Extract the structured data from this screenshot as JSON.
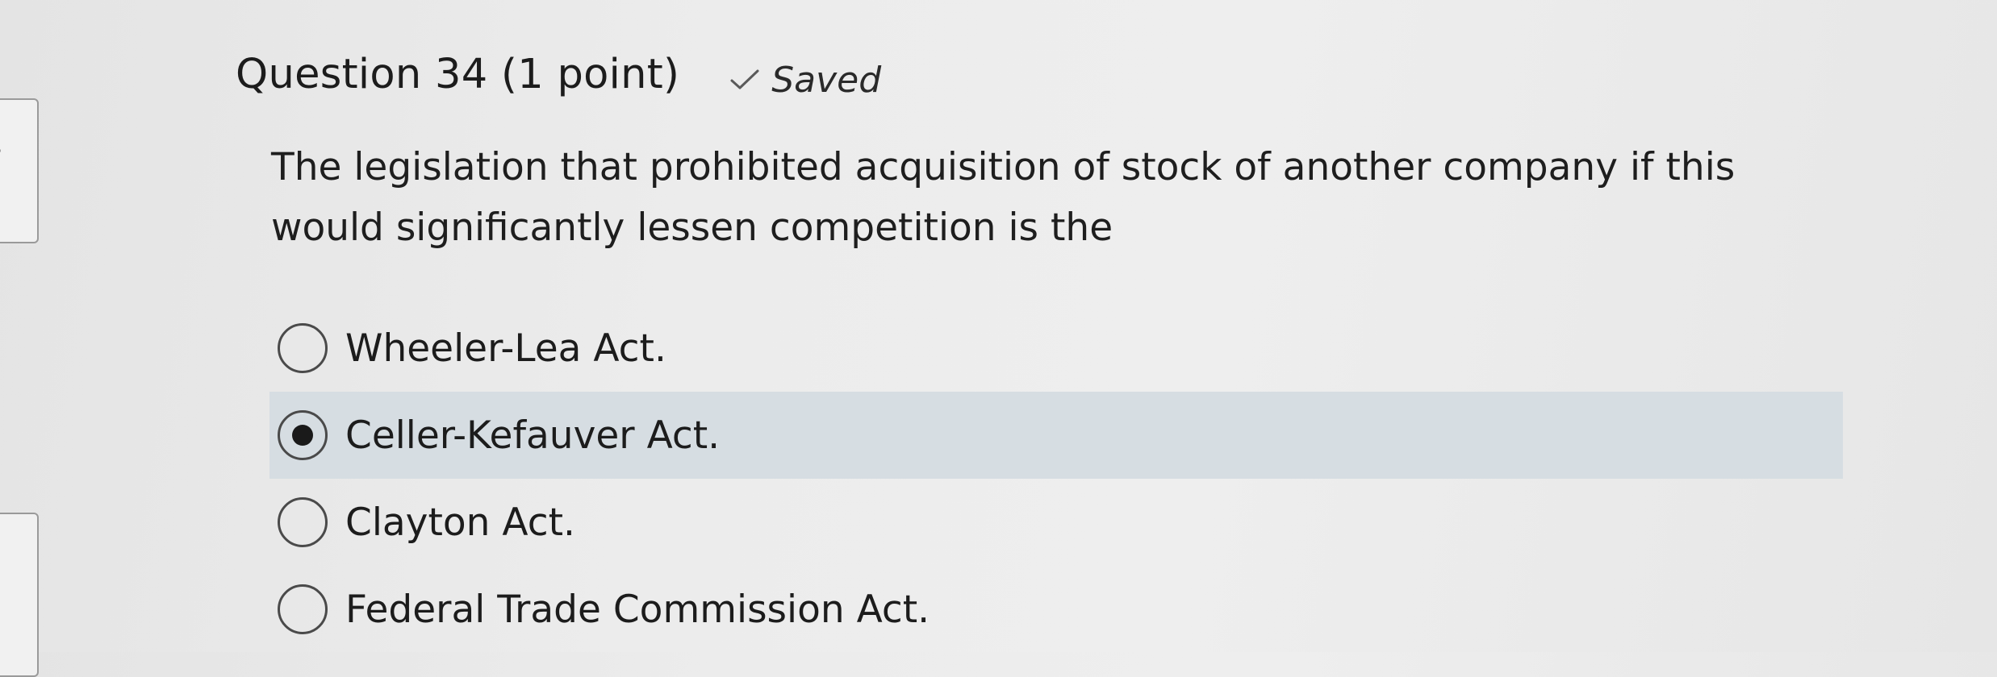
{
  "question": {
    "title": "Question 34 (1 point)",
    "status": "Saved",
    "status_icon": "check-icon",
    "text": "The legislation that prohibited acquisition of stock of another company if this would significantly lessen competition is the"
  },
  "options": [
    {
      "label": "Wheeler-Lea Act.",
      "selected": false
    },
    {
      "label": "Celler-Kefauver Act.",
      "selected": true
    },
    {
      "label": "Clayton Act.",
      "selected": false
    },
    {
      "label": "Federal Trade Commission Act.",
      "selected": false
    }
  ],
  "colors": {
    "selected_row": "#d6dde2",
    "background": "#ececec",
    "text": "#1e1e1e"
  }
}
